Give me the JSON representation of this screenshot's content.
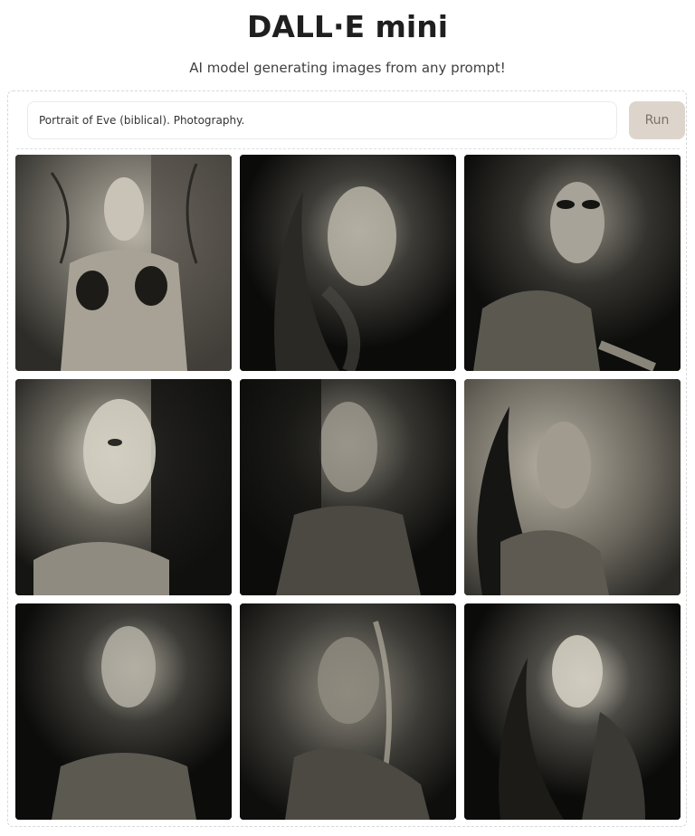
{
  "app": {
    "title": "DALL·E mini",
    "subtitle": "AI model generating images from any prompt!"
  },
  "prompt": {
    "value": "Portrait of Eve (biblical). Photography.",
    "placeholder": ""
  },
  "run_button": {
    "label": "Run"
  },
  "gallery": {
    "images": [
      {
        "name": "generated-image-1",
        "tone": "#5a5650"
      },
      {
        "name": "generated-image-2",
        "tone": "#1a1a18"
      },
      {
        "name": "generated-image-3",
        "tone": "#262623"
      },
      {
        "name": "generated-image-4",
        "tone": "#2a2926"
      },
      {
        "name": "generated-image-5",
        "tone": "#1d1c19"
      },
      {
        "name": "generated-image-6",
        "tone": "#3b3a36"
      },
      {
        "name": "generated-image-7",
        "tone": "#161614"
      },
      {
        "name": "generated-image-8",
        "tone": "#22211e"
      },
      {
        "name": "generated-image-9",
        "tone": "#121210"
      }
    ]
  },
  "colors": {
    "run_bg": "#ddd5cc",
    "run_text": "#7b7368"
  }
}
